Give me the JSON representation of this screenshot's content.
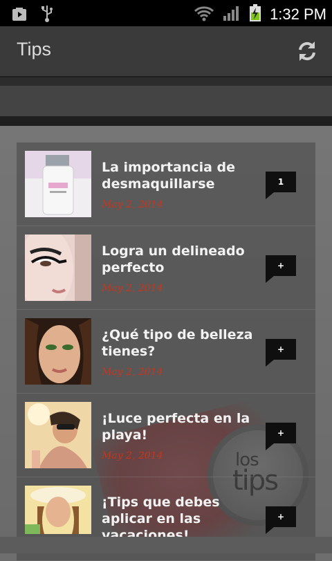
{
  "statusbar": {
    "time": "1:32 PM",
    "icons": [
      "play-store-icon",
      "usb-icon",
      "wifi-icon",
      "signal-icon",
      "battery-charging-icon"
    ]
  },
  "actionbar": {
    "title": "Tips",
    "refresh_icon": "refresh-icon"
  },
  "logo": {
    "line1": "los",
    "line2": "tips"
  },
  "articles": [
    {
      "title": "La importancia de desmaquillarse",
      "date": "May 2, 2014",
      "comments": "1"
    },
    {
      "title": "Logra un delineado perfecto",
      "date": "May 2, 2014",
      "comments": "+"
    },
    {
      "title": "¿Qué tipo de belleza tienes?",
      "date": "May 2, 2014",
      "comments": "+"
    },
    {
      "title": "¡Luce perfecta en la playa!",
      "date": "May 2, 2014",
      "comments": "+"
    },
    {
      "title": "¡Tips que debes aplicar en las vacaciones!",
      "date": "",
      "comments": "+"
    }
  ],
  "colors": {
    "accent_date": "#c4371f",
    "actionbar": "#3a3a3a",
    "statusbar": "#000000"
  }
}
